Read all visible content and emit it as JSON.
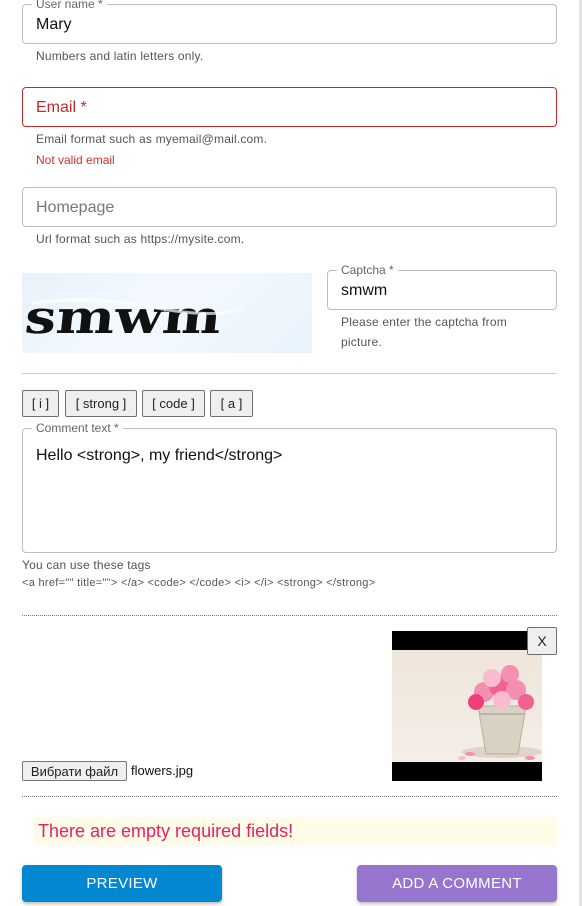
{
  "username": {
    "label": "User name *",
    "value": "Mary",
    "helper": "Numbers and latin letters only."
  },
  "email": {
    "placeholder": "Email *",
    "helper": "Email format such as myemail@mail.com.",
    "error": "Not valid email"
  },
  "homepage": {
    "placeholder": "Homepage",
    "helper": "Url format such as https://mysite.com."
  },
  "captcha": {
    "image_text": "smwm",
    "label": "Captcha *",
    "value": "smwm",
    "helper_line1": "Please enter the captcha from",
    "helper_line2": "picture."
  },
  "tag_buttons": [
    "[ i ]",
    "[ strong ]",
    "[ code ]",
    "[ a ]"
  ],
  "comment": {
    "label": "Comment text *",
    "value": "Hello <strong>, my friend</strong>",
    "tags_hint": "You can use these tags",
    "tags_list": "<a href=\"\" title=\"\"> </a> <code> </code> <i> </i> <strong> </strong>"
  },
  "file": {
    "choose_button": "Вибрати файл",
    "filename": "flowers.jpg",
    "remove_button": "X"
  },
  "warning": "There are empty required fields!",
  "actions": {
    "preview": "PREVIEW",
    "add_comment": "ADD A COMMENT"
  },
  "colors": {
    "preview": "#0288d1",
    "add_comment": "#9575cd",
    "error": "#d32f2f",
    "warning_bg": "#fffde7",
    "warning_text": "#e91e63"
  }
}
